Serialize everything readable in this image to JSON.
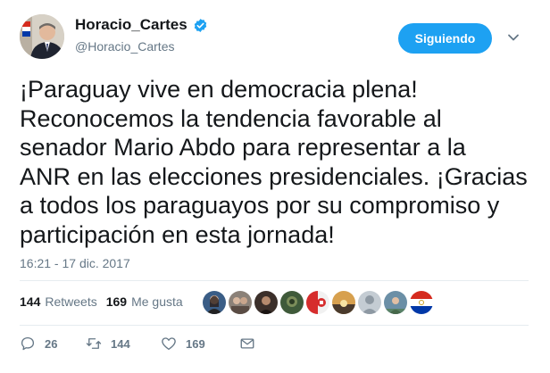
{
  "author": {
    "display_name": "Horacio_Cartes",
    "handle": "@Horacio_Cartes",
    "verified": true
  },
  "follow_button": {
    "label": "Siguiendo"
  },
  "tweet": {
    "lines": [
      "¡Paraguay vive en democracia plena!",
      "Reconocemos la tendencia favorable al",
      "senador Mario Abdo para representar a la",
      "ANR en las elecciones presidenciales. ¡Gracias",
      "a todos los paraguayos por su compromiso y",
      "participación en esta jornada!"
    ],
    "timestamp": "16:21 - 17 dic. 2017"
  },
  "stats": {
    "retweets_count": "144",
    "retweets_label": "Retweets",
    "likes_count": "169",
    "likes_label": "Me gusta"
  },
  "liker_avatars": [
    {
      "icon": "avatar-woman-photo",
      "color": "#3a5d86"
    },
    {
      "icon": "avatar-group-photo",
      "color": "#8b8178"
    },
    {
      "icon": "avatar-dark-photo",
      "color": "#3b2f2a"
    },
    {
      "icon": "avatar-green-photo",
      "color": "#3f5a3a"
    },
    {
      "icon": "avatar-red-logo",
      "color": "#d62d2d"
    },
    {
      "icon": "avatar-sunset-photo",
      "color": "#d7a04e"
    },
    {
      "icon": "avatar-default-egg",
      "color": "#a9b4bd"
    },
    {
      "icon": "avatar-outdoor-photo",
      "color": "#6b8fa6"
    },
    {
      "icon": "avatar-paraguay-flag",
      "color": "#d52b1e"
    }
  ],
  "actions": {
    "reply_count": "26",
    "retweet_count": "144",
    "like_count": "169"
  },
  "colors": {
    "accent": "#1da1f2",
    "text": "#14171a",
    "muted": "#657786",
    "divider": "#e6ecf0"
  }
}
